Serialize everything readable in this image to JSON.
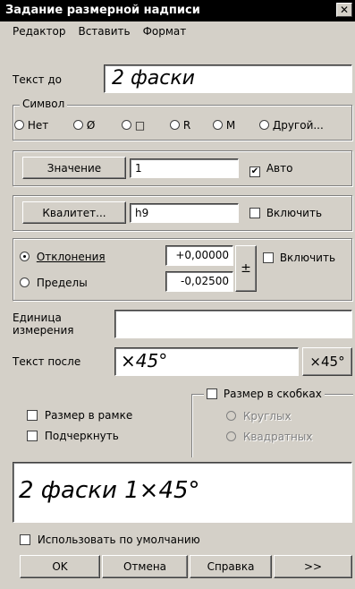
{
  "window": {
    "title": "Задание размерной надписи",
    "close_glyph": "✕"
  },
  "menu": {
    "items": [
      "Редактор",
      "Вставить",
      "Формат"
    ]
  },
  "text_before": {
    "label": "Текст до",
    "value": "2 фаски"
  },
  "symbol": {
    "legend": "Символ",
    "options": [
      {
        "label": "Нет",
        "selected": false
      },
      {
        "label": "Ø",
        "selected": false
      },
      {
        "label": "□",
        "selected": false
      },
      {
        "label": "R",
        "selected": false
      },
      {
        "label": "M",
        "selected": false
      },
      {
        "label": "Другой...",
        "selected": false
      }
    ]
  },
  "value_row": {
    "button": "Значение",
    "value": "1",
    "auto_label": "Авто",
    "auto_checked": true
  },
  "quality_row": {
    "button": "Квалитет...",
    "value": "h9",
    "include_label": "Включить",
    "include_checked": false
  },
  "deviations": {
    "deviations_label": "Отклонения",
    "limits_label": "Пределы",
    "deviations_selected": true,
    "upper": "+0,00000",
    "lower": "-0,02500",
    "plusminus": "±",
    "include_label": "Включить",
    "include_checked": false
  },
  "unit": {
    "label_line1": "Единица",
    "label_line2": "измерения",
    "value": ""
  },
  "text_after": {
    "label": "Текст после",
    "value": "×45°",
    "button": "×45°"
  },
  "brackets": {
    "label": "Размер в скобках",
    "checked": false,
    "round": "Круглых",
    "square": "Квадратных"
  },
  "frame": {
    "label": "Размер в рамке",
    "checked": false
  },
  "underline": {
    "label": "Подчеркнуть",
    "checked": false
  },
  "preview": {
    "text": "2 фаски 1×45°"
  },
  "default_check": {
    "label": "Использовать по умолчанию",
    "checked": false
  },
  "buttons": {
    "ok": "OK",
    "cancel": "Отмена",
    "help": "Справка",
    "more": ">>"
  }
}
